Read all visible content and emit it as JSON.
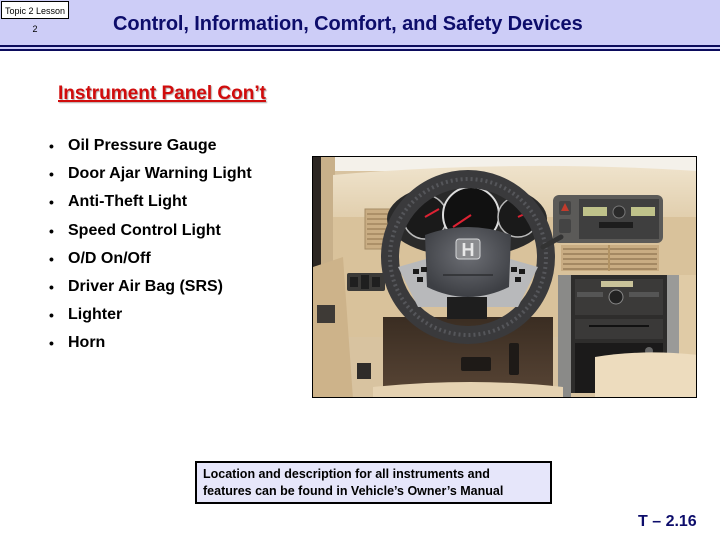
{
  "header": {
    "topic_label": "Topic 2 Lesson 2",
    "title": "Control, Information, Comfort, and Safety Devices",
    "band_color": "#cdcdf7",
    "title_color": "#0d0d6b"
  },
  "section": {
    "subtitle": "Instrument Panel Con’t",
    "subtitle_color": "#d10c0c"
  },
  "bullets": {
    "marker": "•",
    "items": [
      "Oil Pressure Gauge",
      "Door Ajar Warning Light",
      "Anti-Theft Light",
      "Speed Control Light",
      "O/D On/Off",
      "Driver Air Bag (SRS)",
      "Lighter",
      "Horn"
    ]
  },
  "photo": {
    "subject": "vehicle-instrument-panel-photo",
    "logo_glyph": "H"
  },
  "note": {
    "line1": "Location and description for all instruments and",
    "line2": "features can be found in Vehicle’s Owner’s Manual"
  },
  "footer": {
    "slide_number": "T – 2.16"
  }
}
